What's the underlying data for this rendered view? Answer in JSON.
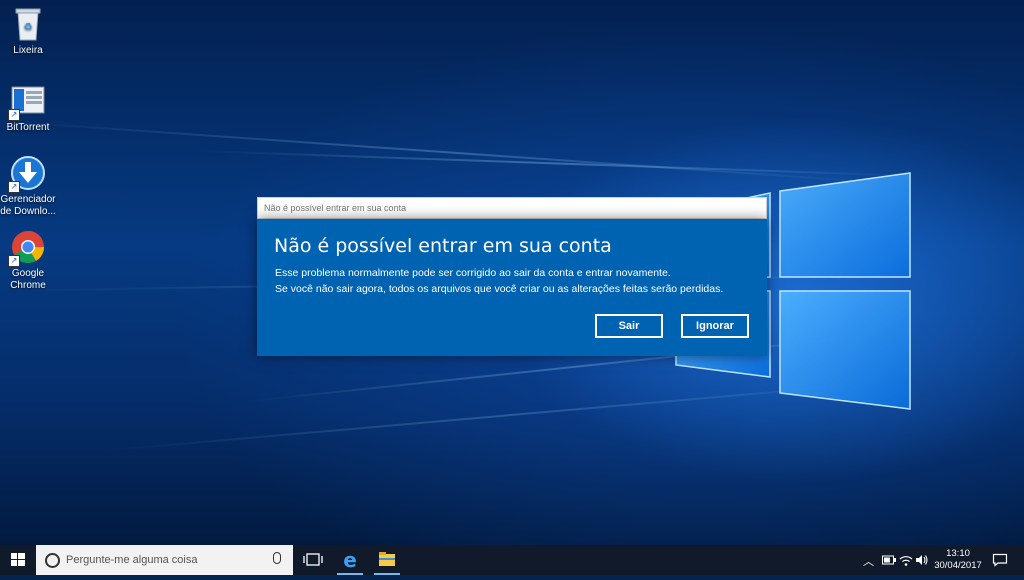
{
  "desktop": {
    "icons": [
      {
        "label": "Lixeira",
        "icon": "recycle-bin-icon"
      },
      {
        "label": "BitTorrent",
        "icon": "bittorrent-icon"
      },
      {
        "label": "Gerenciador de Downlo...",
        "icon": "download-manager-icon"
      },
      {
        "label": "Google Chrome",
        "icon": "chrome-icon"
      }
    ]
  },
  "dialog": {
    "window_title": "Não é possível entrar em sua conta",
    "heading": "Não é possível entrar em sua conta",
    "line1": "Esse problema normalmente pode ser corrigido ao sair da conta e entrar novamente.",
    "line2": "Se você não sair agora, todos os arquivos que você criar ou as alterações feitas serão perdidas.",
    "sign_out_label": "Sair",
    "ignore_label": "Ignorar",
    "accent_color": "#0063b1"
  },
  "taskbar": {
    "search_placeholder": "Pergunte-me alguma coisa",
    "time": "13:10",
    "date": "30/04/2017",
    "pinned": [
      "task-view-icon",
      "edge-icon",
      "file-explorer-icon"
    ],
    "tray": [
      "chevron-up-icon",
      "battery-icon",
      "wifi-icon",
      "volume-icon",
      "notification-icon"
    ]
  }
}
